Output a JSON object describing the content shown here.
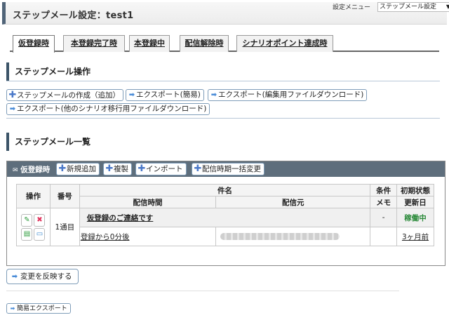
{
  "header": {
    "title": "ステップメール設定：test1",
    "menu_label": "設定メニュー",
    "menu_select": "ステップメール設定"
  },
  "tabs": [
    {
      "label": "仮登録時"
    },
    {
      "label": "本登録完了時"
    },
    {
      "label": "本登録中"
    },
    {
      "label": "配信解除時"
    },
    {
      "label": "シナリオポイント達成時"
    }
  ],
  "operations": {
    "title": "ステップメール操作",
    "create": "ステップメールの作成（追加）",
    "export_simple": "エクスポート(簡易)",
    "export_edit": "エクスポート(編集用ファイルダウンロード)",
    "export_other": "エクスポート(他のシナリオ移行用ファイルダウンロード)"
  },
  "list_section": {
    "title": "ステップメール一覧",
    "panel_label": "仮登録時",
    "buttons": {
      "new": "新規追加",
      "copy": "複製",
      "import": "インポート",
      "bulk": "配信時期一括変更"
    }
  },
  "table": {
    "headers": {
      "op": "操作",
      "num": "番号",
      "subject": "件名",
      "condition": "条件",
      "initial": "初期状態",
      "send_time": "配信時間",
      "sender": "配信元",
      "memo": "メモ",
      "updated": "更新日"
    },
    "rows": [
      {
        "num": "1通目",
        "subject": "仮登録のご連絡です",
        "condition": "-",
        "state": "稼働中",
        "send_time": "登録から0分後",
        "updated": "3ヶ月前"
      }
    ]
  },
  "apply_button": "変更を反映する",
  "simple_export_button": "簡易エクスポート"
}
